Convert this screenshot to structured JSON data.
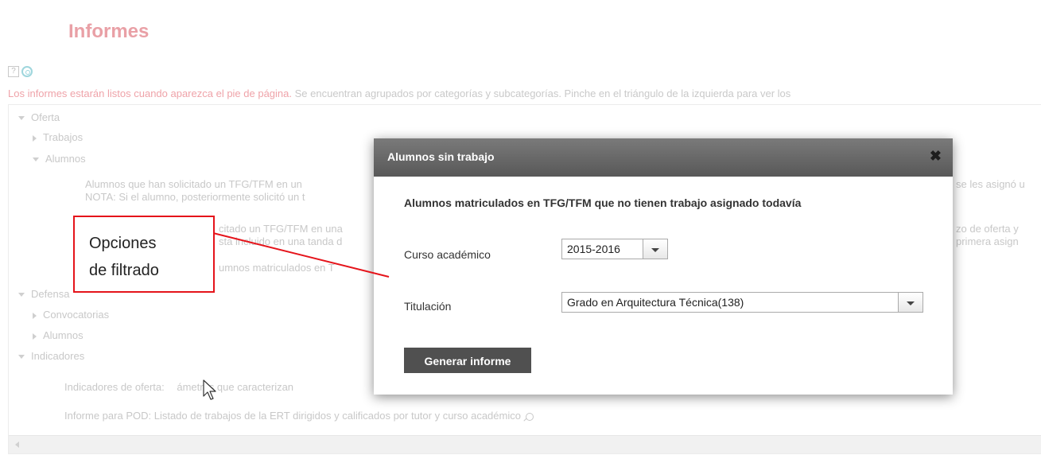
{
  "page": {
    "title": "Informes",
    "intro_highlight": "Los informes estarán listos cuando aparezca el pie de página.",
    "intro_rest": " Se encuentran agrupados por categorías y subcategorías. Pinche en el triángulo de la izquierda para ver los"
  },
  "tree": {
    "oferta": "Oferta",
    "trabajos": "Trabajos",
    "alumnos": "Alumnos",
    "alumnos_line1": "Alumnos que han solicitado un TFG/TFM en un",
    "alumnos_line1_right": "se les asignó u",
    "alumnos_line2": "NOTA: Si el alumno, posteriormente solicitó un t",
    "alumnos_line3": "citado un TFG/TFM en una",
    "alumnos_line3_right": "zo de oferta y",
    "alumnos_line4": "sta incluido en una tanda d",
    "alumnos_line4_right": "primera asign",
    "alumnos_line5": "umnos matriculados en T",
    "defensa": "Defensa",
    "convocatorias": "Convocatorias",
    "alumnos_defensa": "Alumnos",
    "indicadores": "Indicadores",
    "indicadores_oferta_a": "Indicadores de oferta: ",
    "indicadores_oferta_b": "ámetros que caracterizan",
    "informe_pod": "Informe para POD: Listado de trabajos de la ERT dirigidos y calificados por tutor y curso académico"
  },
  "annotation": {
    "line1": "Opciones",
    "line2": "de filtrado",
    "color": "#e5141b"
  },
  "modal": {
    "title": "Alumnos sin trabajo",
    "heading": "Alumnos matriculados en TFG/TFM que no tienen trabajo asignado todavía",
    "curso_label": "Curso académico",
    "curso_value": "2015-2016",
    "titulacion_label": "Titulación",
    "titulacion_value": "Grado en Arquitectura Técnica(138)",
    "generate_label": "Generar informe"
  },
  "icons": {
    "help": "help-icon",
    "info": "info-icon",
    "close": "close-icon",
    "search": "search-icon",
    "cursor": "cursor-icon"
  }
}
